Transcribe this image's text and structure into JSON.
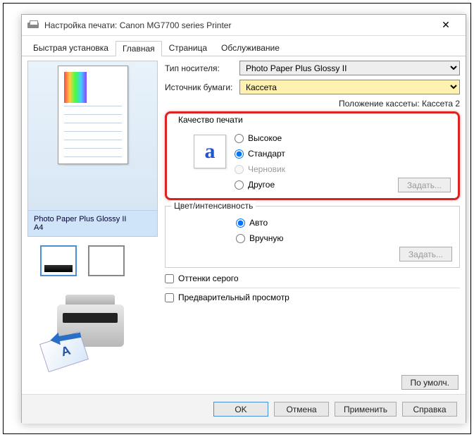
{
  "window": {
    "title": "Настройка печати: Canon MG7700 series Printer"
  },
  "tabs": [
    {
      "label": "Быстрая установка"
    },
    {
      "label": "Главная"
    },
    {
      "label": "Страница"
    },
    {
      "label": "Обслуживание"
    }
  ],
  "preview": {
    "paper_label": "Photo Paper Plus Glossy II\nA4"
  },
  "form": {
    "media_type_label": "Тип носителя:",
    "media_type_value": "Photo Paper Plus Glossy II",
    "paper_source_label": "Источник бумаги:",
    "paper_source_value": "Кассета",
    "cassette_position": "Положение кассеты: Кассета 2"
  },
  "quality": {
    "legend": "Качество печати",
    "options": {
      "high": "Высокое",
      "standard": "Стандарт",
      "draft": "Черновик",
      "custom": "Другое"
    },
    "set_button": "Задать..."
  },
  "color": {
    "legend": "Цвет/интенсивность",
    "options": {
      "auto": "Авто",
      "manual": "Вручную"
    },
    "set_button": "Задать..."
  },
  "checkboxes": {
    "grayscale": "Оттенки серого",
    "preview": "Предварительный просмотр"
  },
  "buttons": {
    "defaults": "По умолч.",
    "ok": "OK",
    "cancel": "Отмена",
    "apply": "Применить",
    "help": "Справка"
  }
}
